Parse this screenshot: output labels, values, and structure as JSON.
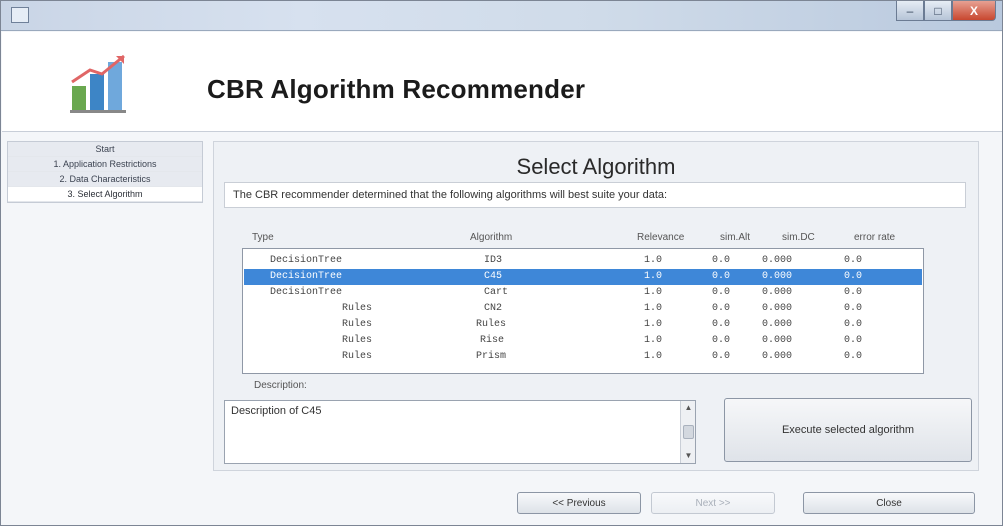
{
  "window": {
    "title": "",
    "minimize_label": "–",
    "maximize_label": "□",
    "close_label": "X"
  },
  "header": {
    "title": "CBR Algorithm Recommender",
    "logo_icon": "bar-chart-logo-icon"
  },
  "steps": [
    {
      "label": "Start"
    },
    {
      "label": "1. Application Restrictions"
    },
    {
      "label": "2. Data Characteristics"
    },
    {
      "label": "3. Select Algorithm",
      "active": true
    }
  ],
  "panel": {
    "title": "Select Algorithm",
    "intro": "The CBR recommender determined that the following algorithms will best suite your data:",
    "columns": [
      "Type",
      "Algorithm",
      "Relevance",
      "sim.Alt",
      "sim.DC",
      "error rate"
    ],
    "rows": [
      {
        "type": "DecisionTree",
        "algorithm": "ID3",
        "relevance": "1.0",
        "sim_alt": "0.0",
        "sim_dc": "0.000",
        "error": "0.0"
      },
      {
        "type": "DecisionTree",
        "algorithm": "C45",
        "relevance": "1.0",
        "sim_alt": "0.0",
        "sim_dc": "0.000",
        "error": "0.0",
        "selected": true
      },
      {
        "type": "DecisionTree",
        "algorithm": "Cart",
        "relevance": "1.0",
        "sim_alt": "0.0",
        "sim_dc": "0.000",
        "error": "0.0"
      },
      {
        "type": "Rules",
        "algorithm": "CN2",
        "relevance": "1.0",
        "sim_alt": "0.0",
        "sim_dc": "0.000",
        "error": "0.0"
      },
      {
        "type": "Rules",
        "algorithm": "Rules",
        "relevance": "1.0",
        "sim_alt": "0.0",
        "sim_dc": "0.000",
        "error": "0.0"
      },
      {
        "type": "Rules",
        "algorithm": "Rise",
        "relevance": "1.0",
        "sim_alt": "0.0",
        "sim_dc": "0.000",
        "error": "0.0"
      },
      {
        "type": "Rules",
        "algorithm": "Prism",
        "relevance": "1.0",
        "sim_alt": "0.0",
        "sim_dc": "0.000",
        "error": "0.0"
      }
    ],
    "description_label": "Description:",
    "description_text": "Description of C45",
    "execute_label": "Execute selected algorithm"
  },
  "nav": {
    "previous_label": "<< Previous",
    "next_label": "Next >>",
    "close_label": "Close"
  },
  "colors": {
    "selection": "#3e87d8",
    "title_bar": "#c9d5e6"
  }
}
